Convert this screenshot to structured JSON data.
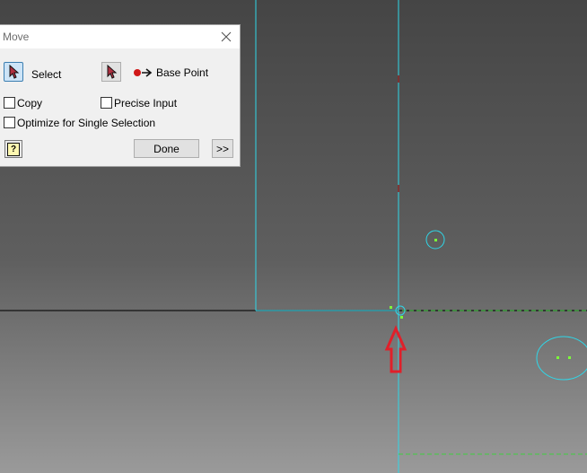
{
  "dialog": {
    "title": "Move",
    "select_label": "Select",
    "base_point_label": "Base Point",
    "copy_label": "Copy",
    "precise_input_label": "Precise Input",
    "optimize_label": "Optimize for Single Selection",
    "done_label": "Done",
    "expand_label": ">>",
    "help_glyph": "?"
  },
  "colors": {
    "sketch_line": "#2fd7e8",
    "dashed_line": "#3fcf3f",
    "point": "#7cfc3a",
    "arrow": "#e0202a",
    "ground_line": "#222222"
  },
  "icons": {
    "select": "cursor-arrow-icon",
    "base_point": "base-point-icon",
    "close": "close-icon",
    "help": "help-icon",
    "annotation": "red-arrow-icon"
  }
}
